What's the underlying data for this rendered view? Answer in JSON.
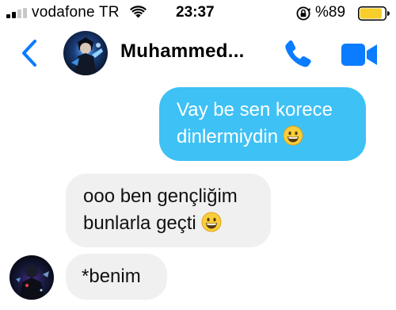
{
  "status_bar": {
    "carrier": "vodafone TR",
    "time": "23:37",
    "battery_percent": "%89",
    "battery_level": 0.89,
    "signal_bars_active": 2,
    "signal_bars_total": 4
  },
  "header": {
    "contact_name": "Muhammed...",
    "accent_color": "#0a7cff"
  },
  "messages": [
    {
      "direction": "outgoing",
      "lines": [
        "Vay be sen korece",
        "dinlermiydin"
      ],
      "emoji": "grinning-face"
    },
    {
      "direction": "incoming",
      "lines": [
        "ooo ben gençliğim",
        "bunlarla geçti"
      ],
      "emoji": "grinning-face"
    },
    {
      "direction": "incoming",
      "lines": [
        "*benim"
      ]
    }
  ],
  "colors": {
    "outgoing_bubble": "#3ec1f5",
    "incoming_bubble": "#f0f0f0",
    "battery_fill": "#f7ce2a"
  },
  "icons": {
    "back": "chevron-left-icon",
    "call": "phone-icon",
    "video": "video-camera-icon",
    "wifi": "wifi-icon",
    "orientation_lock": "orientation-lock-icon",
    "battery": "battery-icon",
    "signal": "signal-bars-icon"
  }
}
